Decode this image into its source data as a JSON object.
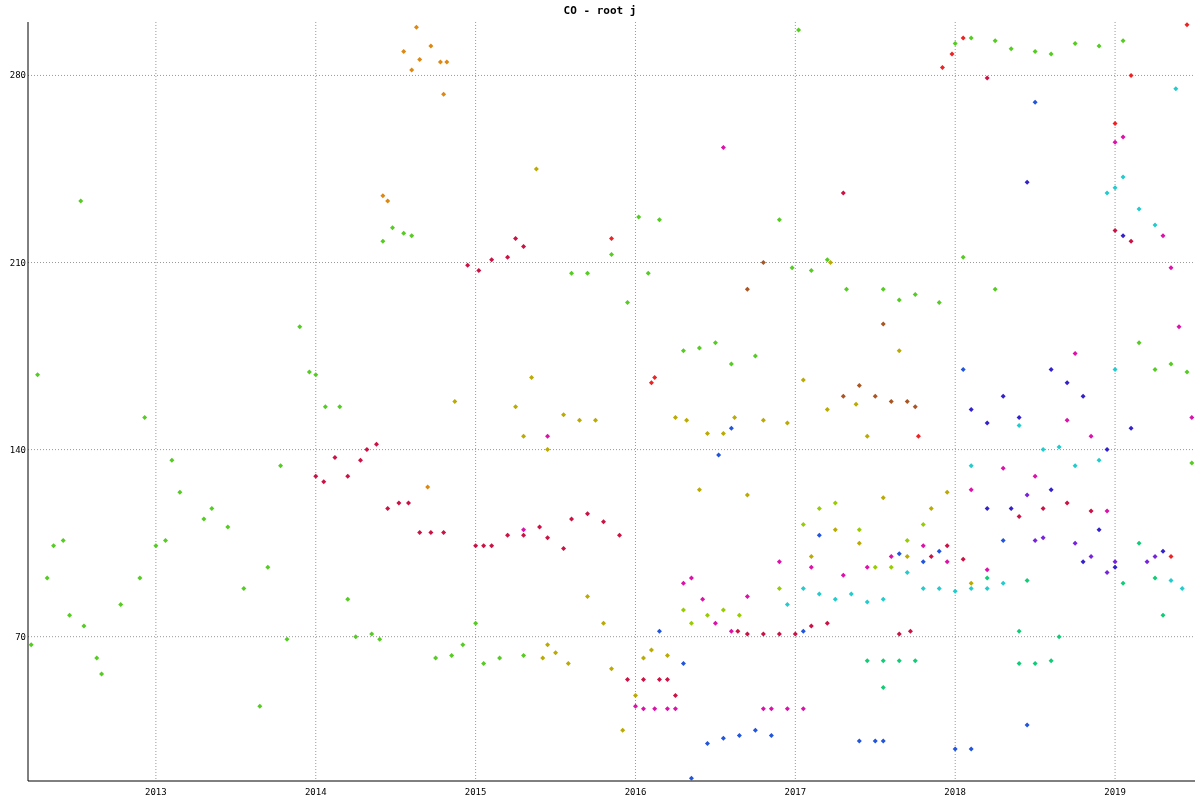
{
  "chart": {
    "chart_data": {
      "type": "scatter",
      "title": "CO - root j",
      "xlim": [
        2012.2,
        2019.5
      ],
      "ylim": [
        16,
        300
      ],
      "xticks": [
        {
          "value": 2013,
          "label": "2013"
        },
        {
          "value": 2014,
          "label": "2014"
        },
        {
          "value": 2015,
          "label": "2015"
        },
        {
          "value": 2016,
          "label": "2016"
        },
        {
          "value": 2017,
          "label": "2017"
        },
        {
          "value": 2018,
          "label": "2018"
        },
        {
          "value": 2019,
          "label": "2019"
        }
      ],
      "yticks": [
        70,
        140,
        210,
        280
      ],
      "grid": true,
      "series": [
        {
          "color": "#55cc22",
          "x": [
            2012.22,
            2012.26,
            2012.32,
            2012.36,
            2012.42,
            2012.46,
            2012.55,
            2012.53,
            2012.63,
            2012.66,
            2012.78,
            2012.9,
            2012.93,
            2013.0,
            2013.06,
            2013.1,
            2013.15,
            2013.3,
            2013.35,
            2013.45,
            2013.55,
            2013.65,
            2013.7,
            2013.78,
            2013.82,
            2013.9,
            2013.96,
            2014.0,
            2014.06,
            2014.15,
            2014.2,
            2014.25,
            2014.35,
            2014.4,
            2014.42,
            2014.48,
            2014.55,
            2014.6,
            2014.75,
            2014.85,
            2014.92,
            2015.0,
            2015.05,
            2015.15,
            2015.3,
            2015.6,
            2015.7,
            2015.85,
            2015.95,
            2016.02,
            2016.08,
            2016.15,
            2016.3,
            2016.4,
            2016.5,
            2016.6,
            2016.75,
            2016.9,
            2016.98,
            2017.02,
            2017.1,
            2017.2,
            2017.32,
            2017.55,
            2017.65,
            2017.75,
            2017.9,
            2018.0,
            2018.1,
            2018.25,
            2018.35,
            2018.5,
            2018.6,
            2018.75,
            2018.9,
            2019.05,
            2019.15,
            2019.25,
            2019.35,
            2019.45,
            2019.48,
            2018.05,
            2018.25
          ],
          "values": [
            67,
            168,
            92,
            104,
            106,
            78,
            74,
            233,
            62,
            56,
            82,
            92,
            152,
            104,
            106,
            136,
            124,
            114,
            118,
            111,
            88,
            44,
            96,
            134,
            69,
            186,
            169,
            168,
            156,
            156,
            84,
            70,
            71,
            69,
            218,
            223,
            221,
            220,
            62,
            63,
            67,
            75,
            60,
            62,
            63,
            206,
            206,
            213,
            195,
            227,
            206,
            226,
            177,
            178,
            180,
            172,
            175,
            226,
            208,
            297,
            207,
            211,
            200,
            200,
            196,
            198,
            195,
            292,
            294,
            293,
            290,
            289,
            288,
            292,
            291,
            293,
            180,
            170,
            172,
            169,
            135,
            212,
            200
          ]
        },
        {
          "color": "#dd8811",
          "x": [
            2014.42,
            2014.45,
            2014.55,
            2014.6,
            2014.65,
            2014.63,
            2014.72,
            2014.78,
            2014.82,
            2014.8,
            2014.7
          ],
          "values": [
            235,
            233,
            289,
            282,
            286,
            298,
            291,
            285,
            285,
            273,
            126
          ]
        },
        {
          "color": "#cc1144",
          "x": [
            2014.0,
            2014.05,
            2014.12,
            2014.2,
            2014.28,
            2014.32,
            2014.38,
            2014.45,
            2014.52,
            2014.58,
            2014.65,
            2014.72,
            2014.8,
            2014.95,
            2015.02,
            2015.1,
            2015.2,
            2015.25,
            2015.3,
            2015.0,
            2015.05,
            2015.1,
            2015.2,
            2015.3,
            2015.4,
            2015.45,
            2015.55,
            2015.6,
            2015.7,
            2015.8,
            2015.9,
            2015.95,
            2016.05,
            2016.15,
            2016.2,
            2016.25,
            2016.64,
            2016.7,
            2016.8,
            2016.9,
            2017.0,
            2017.1,
            2017.2,
            2017.3,
            2017.65,
            2017.72,
            2017.85,
            2017.95,
            2018.05,
            2018.2,
            2018.4,
            2018.55,
            2018.7,
            2018.85,
            2019.0,
            2019.1
          ],
          "values": [
            130,
            128,
            137,
            130,
            136,
            140,
            142,
            118,
            120,
            120,
            109,
            109,
            109,
            209,
            207,
            211,
            212,
            219,
            216,
            104,
            104,
            104,
            108,
            108,
            111,
            107,
            103,
            114,
            116,
            113,
            108,
            54,
            54,
            54,
            54,
            48,
            72,
            71,
            71,
            71,
            71,
            74,
            75,
            236,
            71,
            72,
            100,
            104,
            99,
            279,
            115,
            118,
            120,
            117,
            222,
            218
          ]
        },
        {
          "color": "#ee2222",
          "x": [
            2015.85,
            2016.1,
            2016.12,
            2017.77,
            2017.92,
            2017.98,
            2018.05,
            2019.0,
            2019.1,
            2019.45,
            2019.35
          ],
          "values": [
            219,
            165,
            167,
            145,
            283,
            288,
            294,
            262,
            280,
            299,
            100
          ]
        },
        {
          "color": "#bbaa00",
          "x": [
            2014.87,
            2015.25,
            2015.3,
            2015.35,
            2015.38,
            2015.45,
            2015.55,
            2015.65,
            2015.75,
            2015.5,
            2015.45,
            2015.42,
            2015.58,
            2015.7,
            2015.8,
            2015.85,
            2015.92,
            2016.0,
            2016.05,
            2016.1,
            2016.2,
            2016.25,
            2016.32,
            2016.4,
            2016.45,
            2016.55,
            2016.62,
            2016.7,
            2016.8,
            2016.95,
            2017.05,
            2017.2,
            2017.22,
            2017.38,
            2017.45,
            2017.55,
            2017.65,
            2017.7,
            2017.85,
            2017.95,
            2018.1,
            2017.1,
            2017.25,
            2017.4
          ],
          "values": [
            158,
            156,
            145,
            167,
            245,
            140,
            153,
            151,
            151,
            64,
            67,
            62,
            60,
            85,
            75,
            58,
            35,
            48,
            62,
            65,
            63,
            152,
            151,
            125,
            146,
            146,
            152,
            123,
            151,
            150,
            166,
            155,
            210,
            157,
            145,
            122,
            177,
            100,
            118,
            124,
            90,
            100,
            110,
            105
          ]
        },
        {
          "color": "#aa5522",
          "x": [
            2017.3,
            2017.4,
            2017.5,
            2017.6,
            2017.7,
            2017.75,
            2017.55,
            2016.8,
            2016.7
          ],
          "values": [
            160,
            164,
            160,
            158,
            158,
            156,
            187,
            210,
            200
          ]
        },
        {
          "color": "#dd11aa",
          "x": [
            2015.3,
            2015.45,
            2016.0,
            2016.05,
            2016.12,
            2016.2,
            2016.25,
            2016.3,
            2016.35,
            2016.42,
            2016.5,
            2016.6,
            2016.7,
            2016.8,
            2016.85,
            2016.95,
            2017.05,
            2016.55,
            2016.9,
            2017.1,
            2017.3,
            2017.45,
            2017.6,
            2017.8,
            2018.2,
            2018.3,
            2018.5,
            2018.7,
            2018.75,
            2018.85,
            2018.95,
            2019.0,
            2019.05,
            2019.3,
            2019.35,
            2019.4,
            2019.48,
            2017.95,
            2018.1
          ],
          "values": [
            110,
            145,
            44,
            43,
            43,
            43,
            43,
            90,
            92,
            84,
            75,
            72,
            85,
            43,
            43,
            43,
            43,
            253,
            98,
            96,
            93,
            96,
            100,
            104,
            95,
            133,
            130,
            151,
            176,
            145,
            117,
            255,
            257,
            220,
            208,
            186,
            152,
            98,
            125
          ]
        },
        {
          "color": "#2255dd",
          "x": [
            2016.35,
            2016.45,
            2016.55,
            2016.65,
            2016.75,
            2016.85,
            2016.52,
            2016.6,
            2016.3,
            2016.15,
            2017.05,
            2017.15,
            2017.4,
            2017.5,
            2017.55,
            2018.0,
            2018.1,
            2018.45,
            2018.3,
            2018.5,
            2018.05,
            2017.65,
            2017.8,
            2017.9
          ],
          "values": [
            17,
            30,
            32,
            33,
            35,
            33,
            138,
            148,
            60,
            72,
            72,
            108,
            31,
            31,
            31,
            28,
            28,
            37,
            106,
            270,
            170,
            101,
            98,
            102
          ]
        },
        {
          "color": "#3322cc",
          "x": [
            2018.1,
            2018.2,
            2018.3,
            2018.4,
            2018.45,
            2018.6,
            2018.7,
            2018.8,
            2018.95,
            2019.05,
            2019.1,
            2019.3,
            2018.9,
            2018.6,
            2018.35,
            2018.2,
            2018.8,
            2019.0
          ],
          "values": [
            155,
            150,
            160,
            152,
            240,
            170,
            165,
            160,
            140,
            220,
            148,
            102,
            110,
            125,
            118,
            118,
            98,
            96
          ]
        },
        {
          "color": "#22cccc",
          "x": [
            2016.95,
            2017.05,
            2017.15,
            2017.25,
            2017.35,
            2017.45,
            2017.55,
            2017.7,
            2017.8,
            2017.9,
            2018.0,
            2018.1,
            2018.2,
            2018.3,
            2018.4,
            2018.55,
            2018.65,
            2018.75,
            2018.9,
            2018.95,
            2019.0,
            2019.05,
            2019.15,
            2019.25,
            2019.35,
            2019.42,
            2019.38,
            2019.0,
            2018.1
          ],
          "values": [
            82,
            88,
            86,
            84,
            86,
            83,
            84,
            94,
            88,
            88,
            87,
            88,
            88,
            90,
            149,
            140,
            141,
            134,
            136,
            236,
            238,
            242,
            230,
            224,
            91,
            88,
            275,
            170,
            134
          ]
        },
        {
          "color": "#11cc77",
          "x": [
            2017.45,
            2017.55,
            2017.65,
            2017.75,
            2017.55,
            2018.4,
            2018.5,
            2018.6,
            2018.65,
            2018.4,
            2018.2,
            2018.45,
            2019.05,
            2019.15,
            2019.25,
            2019.3
          ],
          "values": [
            61,
            61,
            61,
            61,
            51,
            60,
            60,
            61,
            70,
            72,
            92,
            91,
            90,
            105,
            92,
            78
          ]
        },
        {
          "color": "#7722dd",
          "x": [
            2018.75,
            2018.85,
            2018.95,
            2019.0,
            2019.2,
            2019.25,
            2018.45,
            2018.5,
            2018.55
          ],
          "values": [
            105,
            100,
            94,
            98,
            98,
            100,
            123,
            106,
            107
          ]
        },
        {
          "color": "#99cc00",
          "x": [
            2016.3,
            2016.35,
            2016.45,
            2016.55,
            2016.65,
            2016.9,
            2017.05,
            2017.15,
            2017.25,
            2017.4,
            2017.5,
            2017.6,
            2017.7,
            2017.8
          ],
          "values": [
            80,
            75,
            78,
            80,
            78,
            88,
            112,
            118,
            120,
            110,
            96,
            96,
            106,
            112
          ]
        }
      ]
    }
  }
}
